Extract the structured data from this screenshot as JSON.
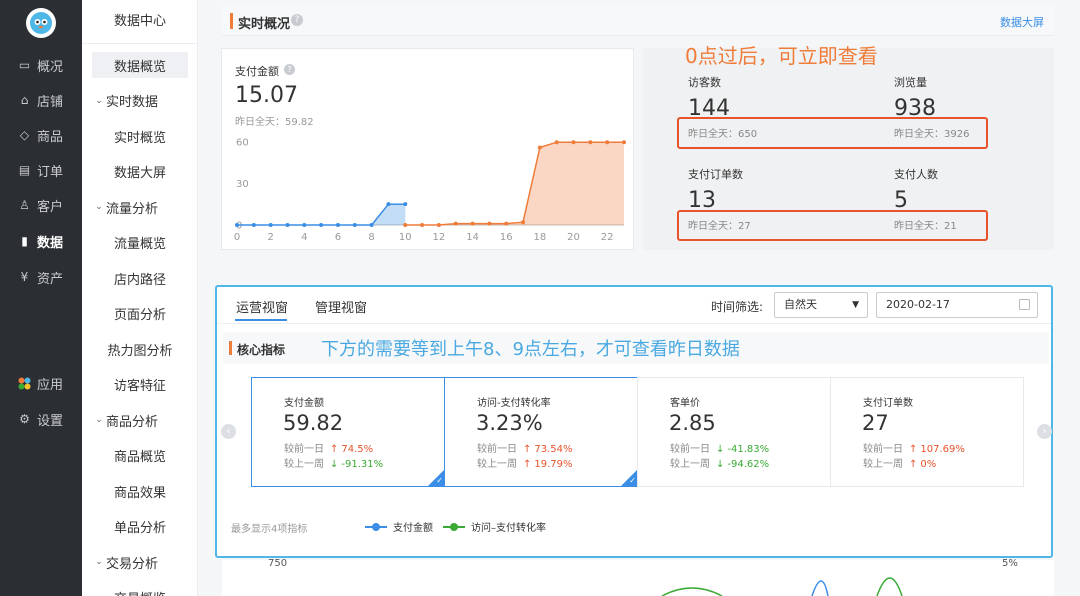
{
  "nav_primary": {
    "items": [
      {
        "label": "概况",
        "icon": "monitor-icon"
      },
      {
        "label": "店铺",
        "icon": "store-icon"
      },
      {
        "label": "商品",
        "icon": "tag-icon"
      },
      {
        "label": "订单",
        "icon": "list-icon"
      },
      {
        "label": "客户",
        "icon": "user-icon"
      },
      {
        "label": "数据",
        "icon": "bar-chart-icon",
        "active": true
      },
      {
        "label": "资产",
        "icon": "yen-icon"
      },
      {
        "label": "应用",
        "icon": "apps-icon"
      },
      {
        "label": "设置",
        "icon": "gear-icon"
      }
    ]
  },
  "nav_secondary": {
    "title": "数据中心",
    "items": [
      {
        "label": "数据概览",
        "kind": "selected"
      },
      {
        "label": "实时数据",
        "kind": "group"
      },
      {
        "label": "实时概览",
        "kind": "sub"
      },
      {
        "label": "数据大屏",
        "kind": "sub"
      },
      {
        "label": "流量分析",
        "kind": "group"
      },
      {
        "label": "流量概览",
        "kind": "sub"
      },
      {
        "label": "店内路径",
        "kind": "sub"
      },
      {
        "label": "页面分析",
        "kind": "sub"
      },
      {
        "label": "热力图分析",
        "kind": "sub"
      },
      {
        "label": "访客特征",
        "kind": "sub"
      },
      {
        "label": "商品分析",
        "kind": "group"
      },
      {
        "label": "商品概览",
        "kind": "sub"
      },
      {
        "label": "商品效果",
        "kind": "sub"
      },
      {
        "label": "单品分析",
        "kind": "sub"
      },
      {
        "label": "交易分析",
        "kind": "group"
      },
      {
        "label": "交易概览",
        "kind": "sub"
      }
    ]
  },
  "realtime": {
    "title": "实时概况",
    "help": "?",
    "link": "数据大屏",
    "pay": {
      "label": "支付金额",
      "value": "15.07",
      "yesterday": "昨日全天：59.82"
    },
    "annotation": "0点过后，可立即查看",
    "stats": [
      {
        "label": "访客数",
        "value": "144",
        "yesterday": "昨日全天：650"
      },
      {
        "label": "浏览量",
        "value": "938",
        "yesterday": "昨日全天：3926"
      },
      {
        "label": "支付订单数",
        "value": "13",
        "yesterday": "昨日全天：27"
      },
      {
        "label": "支付人数",
        "value": "5",
        "yesterday": "昨日全天：21"
      }
    ]
  },
  "chart_data": {
    "type": "area",
    "x": [
      0,
      2,
      4,
      6,
      8,
      10,
      12,
      14,
      16,
      18,
      20,
      22
    ],
    "y_ticks": [
      0,
      30,
      60
    ],
    "ylim": [
      0,
      60
    ],
    "xlim": [
      0,
      23
    ],
    "series": [
      {
        "color": "#3a8ee6",
        "x": [
          0,
          1,
          2,
          3,
          4,
          5,
          6,
          7,
          8,
          9,
          10
        ],
        "values": [
          0,
          0,
          0,
          0,
          0,
          0,
          0,
          0,
          0,
          15.07,
          15.07
        ]
      },
      {
        "color": "#f07c3a",
        "x": [
          10,
          11,
          12,
          13,
          14,
          15,
          16,
          17,
          18,
          19,
          20,
          21,
          22,
          23
        ],
        "values": [
          0,
          0,
          0,
          1,
          1,
          1,
          1,
          2,
          56,
          59.82,
          59.82,
          59.82,
          59.82,
          59.82
        ]
      }
    ]
  },
  "core": {
    "tabs": [
      "运营视窗",
      "管理视窗"
    ],
    "filter_label": "时间筛选:",
    "select_value": "自然天",
    "select_arrow": "▼",
    "date_value": "2020-02-17",
    "title": "核心指标",
    "annotation": "下方的需要等到上午8、9点左右，才可查看昨日数据",
    "prev_label": "‹",
    "next_label": "›",
    "metrics": [
      {
        "label": "支付金额",
        "value": "59.82",
        "d_label": "较前一日",
        "d_arrow": "↑",
        "d_val": "74.5%",
        "d_dir": "up",
        "w_label": "较上一周",
        "w_arrow": "↓",
        "w_val": "-91.31%",
        "w_dir": "down",
        "selected": true
      },
      {
        "label": "访问-支付转化率",
        "value": "3.23%",
        "d_label": "较前一日",
        "d_arrow": "↑",
        "d_val": "73.54%",
        "d_dir": "up",
        "w_label": "较上一周",
        "w_arrow": "↑",
        "w_val": "19.79%",
        "w_dir": "up",
        "selected": true
      },
      {
        "label": "客单价",
        "value": "2.85",
        "d_label": "较前一日",
        "d_arrow": "↓",
        "d_val": "-41.83%",
        "d_dir": "down",
        "w_label": "较上一周",
        "w_arrow": "↓",
        "w_val": "-94.62%",
        "w_dir": "down",
        "selected": false
      },
      {
        "label": "支付订单数",
        "value": "27",
        "d_label": "较前一日",
        "d_arrow": "↑",
        "d_val": "107.69%",
        "d_dir": "up",
        "w_label": "较上一周",
        "w_arrow": "↑",
        "w_val": "0%",
        "w_dir": "up",
        "selected": false
      }
    ],
    "hint": "最多显示4项指标",
    "legend": [
      {
        "label": "支付金额",
        "color": "#3a8ee6"
      },
      {
        "label": "访问–支付转化率",
        "color": "#3aaa35"
      }
    ]
  },
  "bottom_chart": {
    "left_tick": "750",
    "right_tick": "5%"
  }
}
